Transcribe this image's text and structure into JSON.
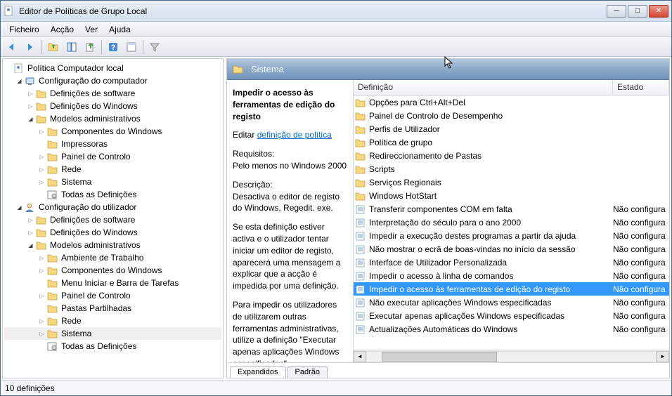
{
  "titlebar": {
    "title": "Editor de Políticas de Grupo Local"
  },
  "menubar": {
    "items": [
      "Ficheiro",
      "Acção",
      "Ver",
      "Ajuda"
    ]
  },
  "toolbar": {
    "buttons": [
      "back",
      "forward",
      "up",
      "tree-view",
      "export",
      "sep",
      "help",
      "properties",
      "sep",
      "filter"
    ]
  },
  "tree": [
    {
      "level": 0,
      "toggle": "",
      "icon": "policy",
      "label": "Política Computador local"
    },
    {
      "level": 1,
      "toggle": "▼",
      "icon": "computer",
      "label": "Configuração do computador"
    },
    {
      "level": 2,
      "toggle": "▶",
      "icon": "folder",
      "label": "Definições de software"
    },
    {
      "level": 2,
      "toggle": "▶",
      "icon": "folder",
      "label": "Definições do Windows"
    },
    {
      "level": 2,
      "toggle": "▼",
      "icon": "folder",
      "label": "Modelos administrativos"
    },
    {
      "level": 3,
      "toggle": "▶",
      "icon": "folder",
      "label": "Componentes do Windows"
    },
    {
      "level": 3,
      "toggle": "",
      "icon": "folder",
      "label": "Impressoras"
    },
    {
      "level": 3,
      "toggle": "▶",
      "icon": "folder",
      "label": "Painel de Controlo"
    },
    {
      "level": 3,
      "toggle": "▶",
      "icon": "folder",
      "label": "Rede"
    },
    {
      "level": 3,
      "toggle": "▶",
      "icon": "folder",
      "label": "Sistema"
    },
    {
      "level": 3,
      "toggle": "",
      "icon": "settings",
      "label": "Todas as Definições"
    },
    {
      "level": 1,
      "toggle": "▼",
      "icon": "user",
      "label": "Configuração do utilizador"
    },
    {
      "level": 2,
      "toggle": "▶",
      "icon": "folder",
      "label": "Definições de software"
    },
    {
      "level": 2,
      "toggle": "▶",
      "icon": "folder",
      "label": "Definições do Windows"
    },
    {
      "level": 2,
      "toggle": "▼",
      "icon": "folder",
      "label": "Modelos administrativos"
    },
    {
      "level": 3,
      "toggle": "▶",
      "icon": "folder",
      "label": "Ambiente de Trabalho"
    },
    {
      "level": 3,
      "toggle": "▶",
      "icon": "folder",
      "label": "Componentes do Windows"
    },
    {
      "level": 3,
      "toggle": "",
      "icon": "folder",
      "label": "Menu Iniciar e Barra de Tarefas"
    },
    {
      "level": 3,
      "toggle": "▶",
      "icon": "folder",
      "label": "Painel de Controlo"
    },
    {
      "level": 3,
      "toggle": "",
      "icon": "folder",
      "label": "Pastas Partilhadas"
    },
    {
      "level": 3,
      "toggle": "▶",
      "icon": "folder",
      "label": "Rede"
    },
    {
      "level": 3,
      "toggle": "▶",
      "icon": "folder",
      "label": "Sistema",
      "selected": true
    },
    {
      "level": 3,
      "toggle": "",
      "icon": "settings",
      "label": "Todas as Definições"
    }
  ],
  "breadcrumb": {
    "label": "Sistema"
  },
  "detail": {
    "title": "Impedir o acesso às ferramentas de edição do registo",
    "edit_prefix": "Editar ",
    "edit_link": "definição de política",
    "req_label": "Requisitos:",
    "req_text": "Pelo menos no Windows 2000",
    "desc_label": "Descrição:",
    "desc1": "Desactiva o editor de registo do Windows, Regedit. exe.",
    "desc2": "Se esta definição estiver activa e o utilizador tentar iniciar um editor de registo, aparecerá uma mensagem a explicar que a acção é impedida por uma definição.",
    "desc3": "Para impedir os utilizadores de utilizarem outras ferramentas administrativas, utilize a definição \"Executar apenas aplicações Windows especificadas\"."
  },
  "list": {
    "col_def": "Definição",
    "col_state": "Estado",
    "items": [
      {
        "icon": "folder",
        "name": "Opções para Ctrl+Alt+Del",
        "state": ""
      },
      {
        "icon": "folder",
        "name": "Painel de Controlo de Desempenho",
        "state": ""
      },
      {
        "icon": "folder",
        "name": "Perfis de Utilizador",
        "state": ""
      },
      {
        "icon": "folder",
        "name": "Política de grupo",
        "state": ""
      },
      {
        "icon": "folder",
        "name": "Redireccionamento de Pastas",
        "state": ""
      },
      {
        "icon": "folder",
        "name": "Scripts",
        "state": ""
      },
      {
        "icon": "folder",
        "name": "Serviços Regionais",
        "state": ""
      },
      {
        "icon": "folder",
        "name": "Windows HotStart",
        "state": ""
      },
      {
        "icon": "setting",
        "name": "Transferir componentes COM em falta",
        "state": "Não configura"
      },
      {
        "icon": "setting",
        "name": "Interpretação do século para o ano 2000",
        "state": "Não configura"
      },
      {
        "icon": "setting",
        "name": "Impedir a execução destes programas a partir da ajuda",
        "state": "Não configura"
      },
      {
        "icon": "setting",
        "name": "Não mostrar o ecrã de boas-vindas no início da sessão",
        "state": "Não configura"
      },
      {
        "icon": "setting",
        "name": "Interface de Utilizador Personalizada",
        "state": "Não configura"
      },
      {
        "icon": "setting",
        "name": "Impedir o acesso à linha de comandos",
        "state": "Não configura"
      },
      {
        "icon": "setting",
        "name": "Impedir o acesso às ferramentas de edição do registo",
        "state": "Não configura",
        "selected": true
      },
      {
        "icon": "setting",
        "name": "Não executar aplicações Windows especificadas",
        "state": "Não configura"
      },
      {
        "icon": "setting",
        "name": "Executar apenas aplicações Windows especificadas",
        "state": "Não configura"
      },
      {
        "icon": "setting",
        "name": "Actualizações Automáticas do Windows",
        "state": "Não configura"
      }
    ]
  },
  "tabs": {
    "expanded": "Expandidos",
    "standard": "Padrão"
  },
  "statusbar": {
    "text": "10 definições"
  }
}
